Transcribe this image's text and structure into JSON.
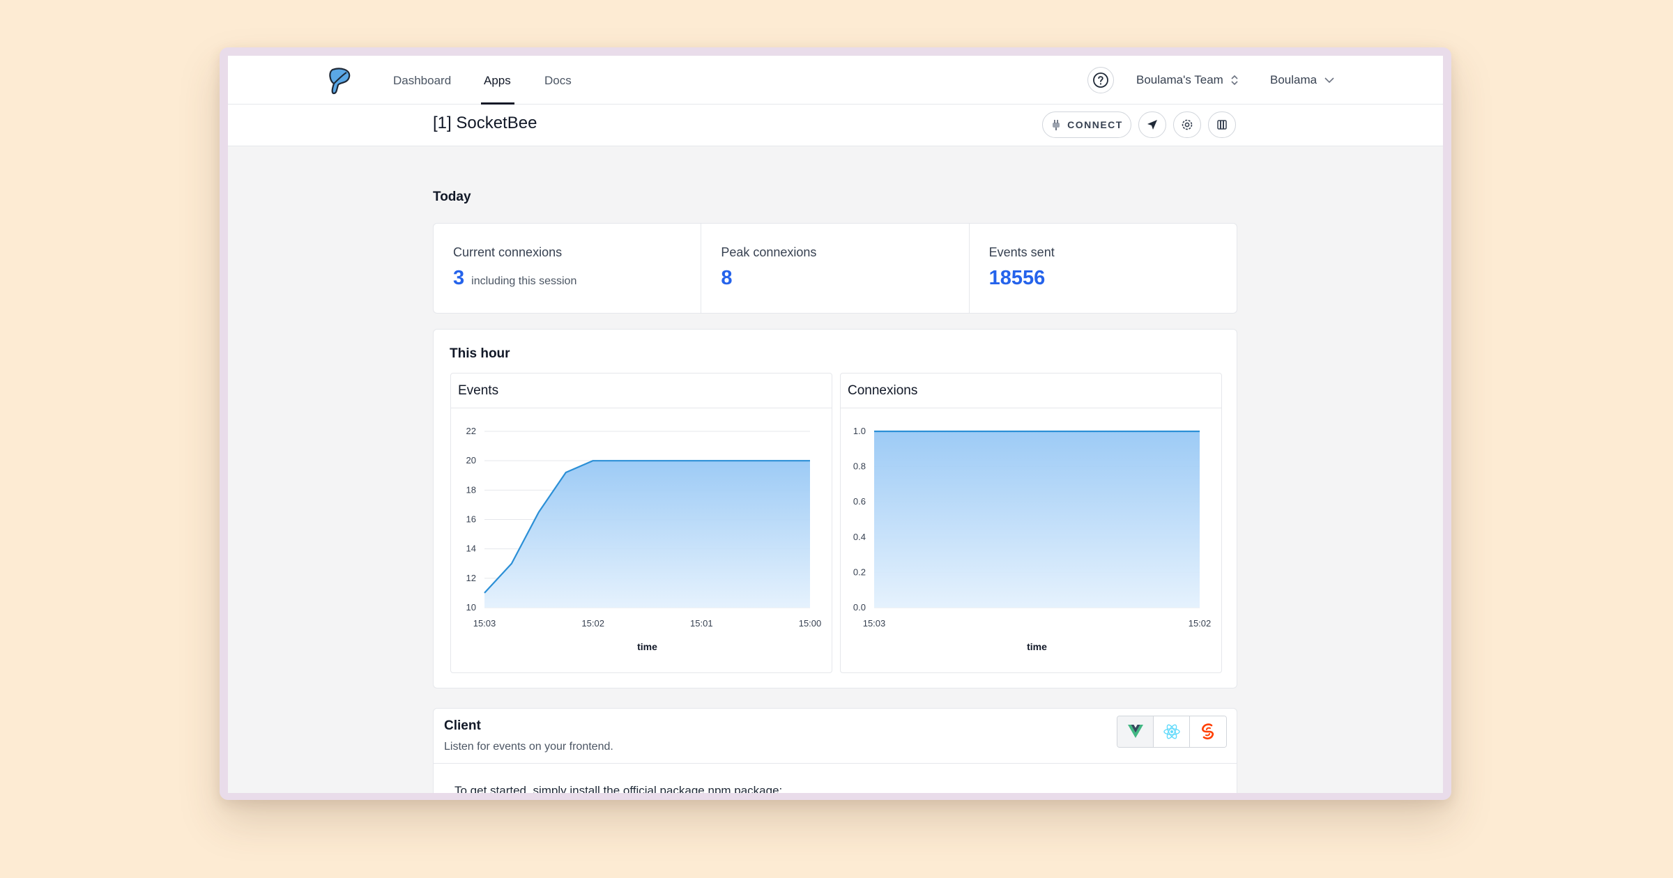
{
  "nav": {
    "items": [
      {
        "label": "Dashboard",
        "active": false
      },
      {
        "label": "Apps",
        "active": true
      },
      {
        "label": "Docs",
        "active": false
      }
    ],
    "team": "Boulama's Team",
    "user": "Boulama"
  },
  "app": {
    "title": "[1] SocketBee",
    "connect_label": "CONNECT"
  },
  "today": {
    "title": "Today",
    "stats": [
      {
        "label": "Current connexions",
        "value": "3",
        "note": "including this session"
      },
      {
        "label": "Peak connexions",
        "value": "8",
        "note": ""
      },
      {
        "label": "Events sent",
        "value": "18556",
        "note": ""
      }
    ]
  },
  "hour": {
    "title": "This hour"
  },
  "chart_data": [
    {
      "type": "area",
      "title": "Events",
      "xlabel": "time",
      "ylabel": "",
      "x": [
        "15:03",
        "15:02",
        "15:01",
        "15:00"
      ],
      "y_ticks": [
        10,
        12,
        14,
        16,
        18,
        20,
        22
      ],
      "ylim": [
        10,
        22
      ],
      "points": [
        [
          0,
          11
        ],
        [
          0.25,
          13
        ],
        [
          0.5,
          16.5
        ],
        [
          0.75,
          19.2
        ],
        [
          1,
          20
        ],
        [
          2,
          20
        ],
        [
          3,
          20
        ]
      ],
      "grid": true,
      "color": "#2b8fd6"
    },
    {
      "type": "area",
      "title": "Connexions",
      "xlabel": "time",
      "ylabel": "",
      "x": [
        "15:03",
        "15:02"
      ],
      "y_ticks": [
        0.0,
        0.2,
        0.4,
        0.6,
        0.8,
        1.0
      ],
      "ylim": [
        0,
        1
      ],
      "points": [
        [
          0,
          1
        ],
        [
          1,
          1
        ]
      ],
      "grid": true,
      "color": "#2b8fd6"
    }
  ],
  "client": {
    "title": "Client",
    "subtitle": "Listen for events on your frontend.",
    "text": "To get started, simply install the official package npm package:",
    "frameworks": [
      "vue-icon",
      "react-icon",
      "svelte-icon"
    ]
  },
  "colors": {
    "accent": "#2563eb",
    "background": "#fdebd3"
  }
}
